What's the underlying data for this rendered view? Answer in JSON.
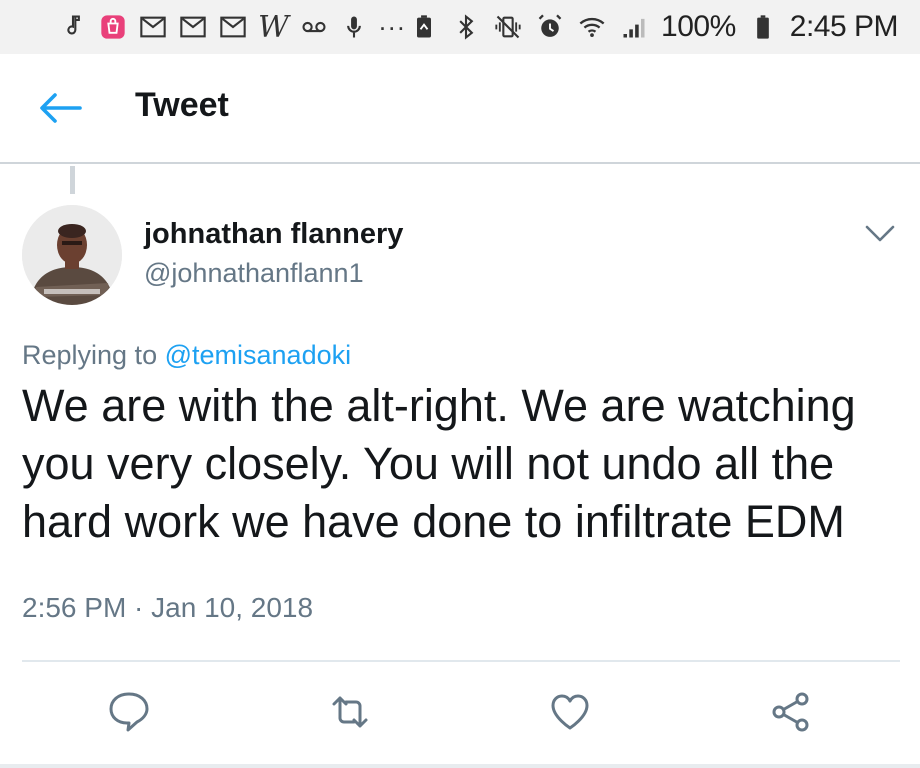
{
  "status_bar": {
    "icons_left": [
      "music-note-icon",
      "shopping-bag-icon",
      "gmail-icon",
      "gmail-icon",
      "gmail-icon",
      "w-app-icon",
      "voicemail-icon",
      "microphone-icon",
      "more-dots-icon"
    ],
    "w_label": "W",
    "icons_right": [
      "battery-saver-icon",
      "bluetooth-icon",
      "vibrate-mute-icon",
      "alarm-icon",
      "wifi-icon",
      "signal-icon"
    ],
    "battery_percent": "100%",
    "time": "2:45 PM"
  },
  "header": {
    "title": "Tweet",
    "accent_color": "#1da1f2"
  },
  "tweet": {
    "author_name": "johnathan flannery",
    "author_handle": "@johnathanflann1",
    "replying_prefix": "Replying to",
    "replying_to": "@temisanadoki",
    "text": "We are with the alt-right. We are watching you very closely. You will not undo all the hard work we have done to infiltrate EDM",
    "timestamp": "2:56 PM · Jan 10, 2018"
  },
  "actions": [
    "reply-icon",
    "retweet-icon",
    "like-icon",
    "share-icon"
  ],
  "colors": {
    "link": "#1da1f2",
    "secondary_text": "#657786",
    "primary_text": "#14171a",
    "divider": "#e1e8ed"
  }
}
